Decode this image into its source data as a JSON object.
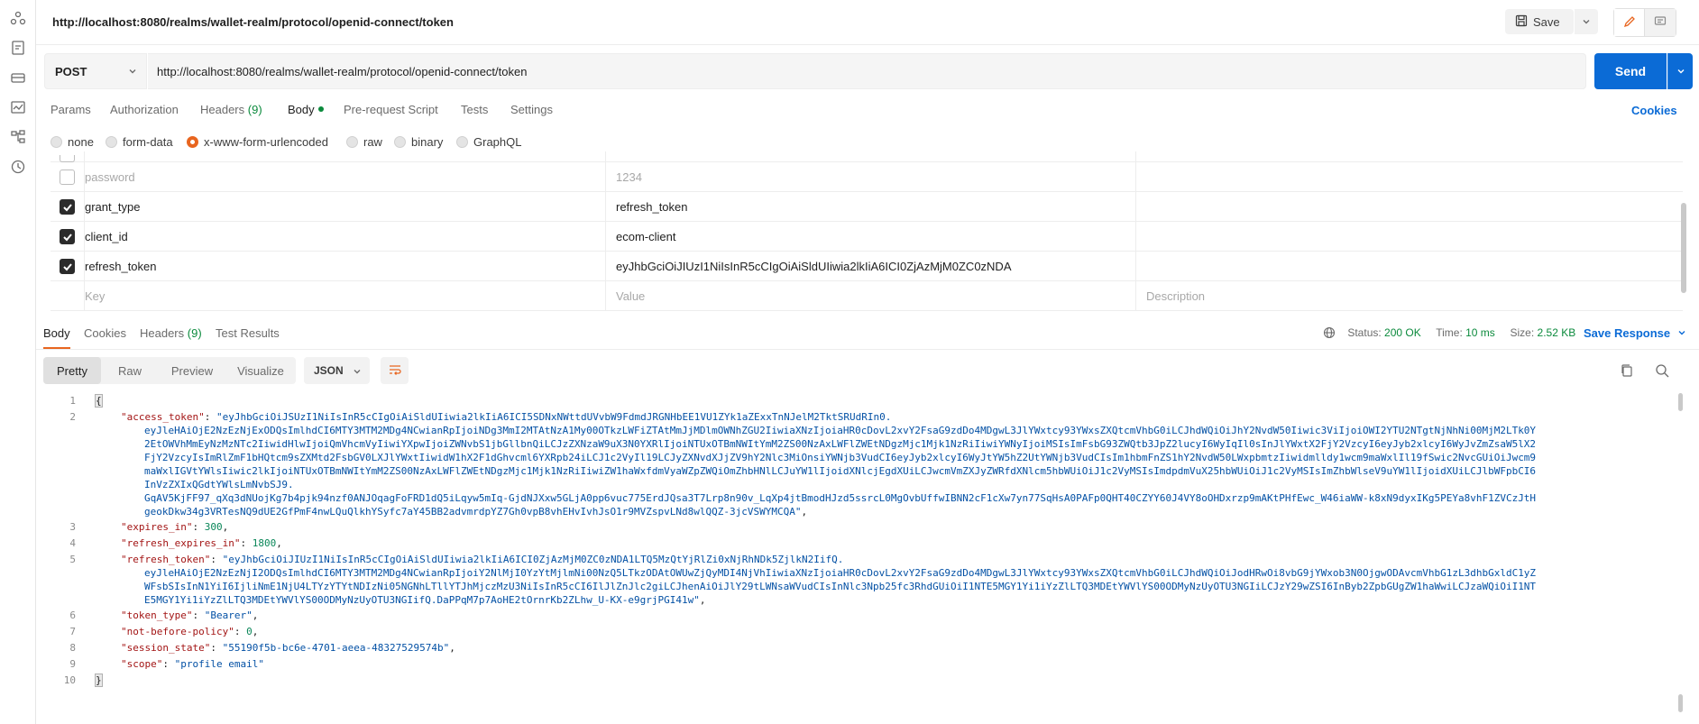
{
  "rail": {
    "icons": [
      "users-icon",
      "collection-icon",
      "environment-icon",
      "monitor-icon",
      "flows-icon",
      "history-icon"
    ]
  },
  "title": {
    "url": "http://localhost:8080/realms/wallet-realm/protocol/openid-connect/token",
    "save_label": "Save"
  },
  "request": {
    "method": "POST",
    "url": "http://localhost:8080/realms/wallet-realm/protocol/openid-connect/token",
    "send_label": "Send"
  },
  "req_tabs": {
    "params": "Params",
    "authorization": "Authorization",
    "headers": "Headers",
    "headers_count": "(9)",
    "body": "Body",
    "prerequest": "Pre-request Script",
    "tests": "Tests",
    "settings": "Settings",
    "cookies": "Cookies"
  },
  "body_types": {
    "none": "none",
    "form_data": "form-data",
    "urlencoded": "x-www-form-urlencoded",
    "raw": "raw",
    "binary": "binary",
    "graphql": "GraphQL"
  },
  "params": {
    "rows": [
      {
        "checked": false,
        "key": "password",
        "value": "1234",
        "description": ""
      },
      {
        "checked": true,
        "key": "grant_type",
        "value": "refresh_token",
        "description": ""
      },
      {
        "checked": true,
        "key": "client_id",
        "value": "ecom-client",
        "description": ""
      },
      {
        "checked": true,
        "key": "refresh_token",
        "value": "eyJhbGciOiJIUzI1NiIsInR5cCIgOiAiSldUIiwia2lkIiA6ICI0ZjAzMjM0ZC0zNDA",
        "description": ""
      }
    ],
    "placeholder_key": "Key",
    "placeholder_value": "Value",
    "placeholder_desc": "Description"
  },
  "response": {
    "tabs": {
      "body": "Body",
      "cookies": "Cookies",
      "headers": "Headers",
      "headers_count": "(9)",
      "test_results": "Test Results"
    },
    "status_label": "Status:",
    "status_value": "200 OK",
    "time_label": "Time:",
    "time_value": "10 ms",
    "size_label": "Size:",
    "size_value": "2.52 KB",
    "save_response": "Save Response",
    "views": {
      "pretty": "Pretty",
      "raw": "Raw",
      "preview": "Preview",
      "visualize": "Visualize"
    },
    "format": "JSON"
  },
  "code": {
    "l1": "{",
    "access_key": "\"access_token\"",
    "access_1": "\"eyJhbGciOiJSUzI1NiIsInR5cCIgOiAiSldUIiwia2lkIiA6ICI5SDNxNWttdUVvbW9FdmdJRGNHbEE1VU1ZYk1aZExxTnNJelM2TktSRUdRIn0.",
    "access_2": "eyJleHAiOjE2NzEzNjExODQsImlhdCI6MTY3MTM2MDg4NCwianRpIjoiNDg3MmI2MTAtNzA1My00OTkzLWFiZTAtMmJjMDlmOWNhZGU2IiwiaXNzIjoiaHR0cDovL2xvY2FsaG9zdDo4MDgwL3JlYWxtcy93YWxsZXQtcmVhbG0iLCJhdWQiOiJhY2NvdW50Iiwic3ViIjoiOWI2YTU2NTgtNjNhNi00MjM2LTk0Y",
    "access_3": "2EtOWVhMmEyNzMzNTc2IiwidHlwIjoiQmVhcmVyIiwiYXpwIjoiZWNvbS1jbGllbnQiLCJzZXNzaW9uX3N0YXRlIjoiNTUxOTBmNWItYmM2ZS00NzAxLWFlZWEtNDgzMjc1Mjk1NzRiIiwiYWNyIjoiMSIsImFsbG93ZWQtb3JpZ2lucyI6WyIqIl0sInJlYWxtX2FjY2VzcyI6eyJyb2xlcyI6WyJvZmZsaW5lX2",
    "access_4": "FjY2VzcyIsImRlZmF1bHQtcm9sZXMtd2FsbGV0LXJlYWxtIiwidW1hX2F1dGhvcml6YXRpb24iLCJ1c2VyIl19LCJyZXNvdXJjZV9hY2Nlc3MiOnsiYWNjb3VudCI6eyJyb2xlcyI6WyJtYW5hZ2UtYWNjb3VudCIsIm1hbmFnZS1hY2NvdW50LWxpbmtzIiwidmlldy1wcm9maWxlIl19fSwic2NvcGUiOiJwcm9",
    "access_5": "maWxlIGVtYWlsIiwic2lkIjoiNTUxOTBmNWItYmM2ZS00NzAxLWFlZWEtNDgzMjc1Mjk1NzRiIiwiZW1haWxfdmVyaWZpZWQiOmZhbHNlLCJuYW1lIjoidXNlcjEgdXUiLCJwcmVmZXJyZWRfdXNlcm5hbWUiOiJ1c2VyMSIsImdpdmVuX25hbWUiOiJ1c2VyMSIsImZhbWlseV9uYW1lIjoidXUiLCJlbWFpbCI6",
    "access_6": "InVzZXIxQGdtYWlsLmNvbSJ9.",
    "access_7": "GqAV5KjFF97_qXq3dNUojKg7b4pjk94nzf0ANJOqagFoFRD1dQ5iLqyw5mIq-GjdNJXxw5GLjA0pp6vuc775ErdJQsa3T7Lrp8n90v_LqXp4jtBmodHJzd5ssrcL0MgOvbUffwIBNN2cF1cXw7yn77SqHsA0PAFp0QHT40CZYY60J4VY8oOHDxrzp9mAKtPHfEwc_W46iaWW-k8xN9dyxIKg5PEYa8vhF1ZVCzJtH",
    "access_8": "geokDkw34g3VRTesNQ9dUE2GfPmF4nwLQuQlkhYSyfc7aY45BB2advmrdpYZ7Gh0vpB8vhEHvIvhJsO1r9MVZspvLNd8wlQQZ-3jcVSWYMCQA\"",
    "expires_key": "\"expires_in\"",
    "expires_val": "300",
    "rexp_key": "\"refresh_expires_in\"",
    "rexp_val": "1800",
    "refresh_key": "\"refresh_token\"",
    "refresh_1": "\"eyJhbGciOiJIUzI1NiIsInR5cCIgOiAiSldUIiwia2lkIiA6ICI0ZjAzMjM0ZC0zNDA1LTQ5MzQtYjRlZi0xNjRhNDk5ZjlkN2IifQ.",
    "refresh_2": "eyJleHAiOjE2NzEzNjI2ODQsImlhdCI6MTY3MTM2MDg4NCwianRpIjoiY2NlMjI0YzYtMjlmNi00NzQ5LTkzODAtOWUwZjQyMDI4NjVhIiwiaXNzIjoiaHR0cDovL2xvY2FsaG9zdDo4MDgwL3JlYWxtcy93YWxsZXQtcmVhbG0iLCJhdWQiOiJodHRwOi8vbG9jYWxob3N0OjgwODAvcmVhbG1zL3dhbGxldC1yZ",
    "refresh_3": "WFsbSIsInN1YiI6IjliNmE1NjU4LTYzYTYtNDIzNi05NGNhLTllYTJhMjczMzU3NiIsInR5cCI6IlJlZnJlc2giLCJhenAiOiJlY29tLWNsaWVudCIsInNlc3Npb25fc3RhdGUiOiI1NTE5MGY1Yi1iYzZlLTQ3MDEtYWVlYS00ODMyNzUyOTU3NGIiLCJzY29wZSI6InByb2ZpbGUgZW1haWwiLCJzaWQiOiI1NT",
    "refresh_4": "E5MGY1Yi1iYzZlLTQ3MDEtYWVlYS00ODMyNzUyOTU3NGIifQ.DaPPqM7p7AoHE2tOrnrKb2ZLhw_U-KX-e9grjPGI41w\"",
    "tokentype_key": "\"token_type\"",
    "tokentype_val": "\"Bearer\"",
    "nbp_key": "\"not-before-policy\"",
    "nbp_val": "0",
    "session_key": "\"session_state\"",
    "session_val": "\"55190f5b-bc6e-4701-aeea-48327529574b\"",
    "scope_key": "\"scope\"",
    "scope_val": "\"profile email\"",
    "l10": "}"
  },
  "colors": {
    "accent": "#e8651f",
    "primary": "#0b6bd6",
    "success": "#0b8a3c"
  }
}
